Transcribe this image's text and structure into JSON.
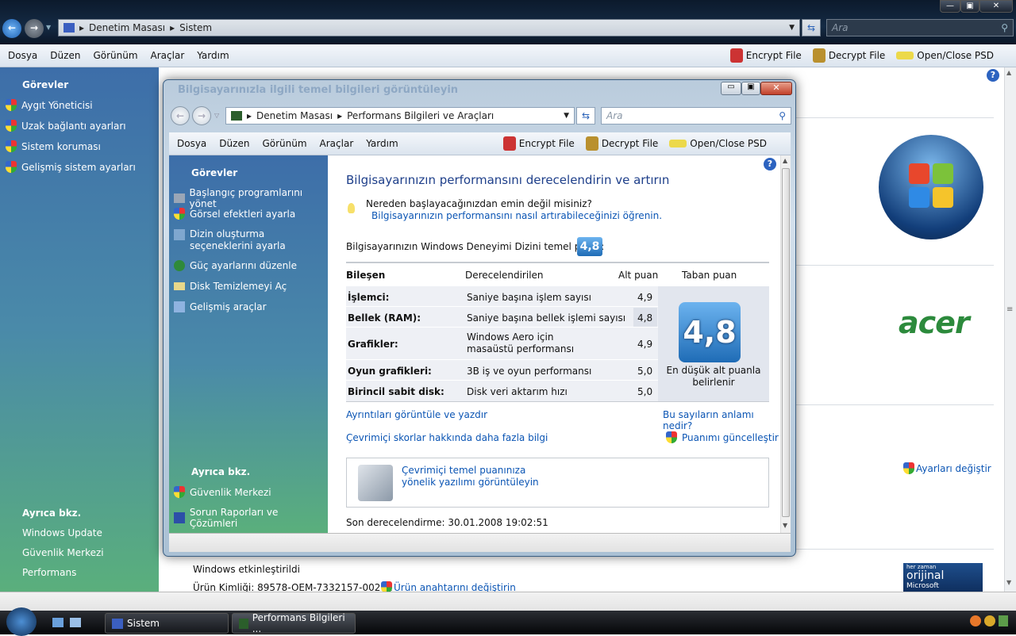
{
  "outer": {
    "breadcrumb": [
      "Denetim Masası",
      "Sistem"
    ],
    "search_placeholder": "Ara",
    "menu": [
      "Dosya",
      "Düzen",
      "Görünüm",
      "Araçlar",
      "Yardım"
    ],
    "tools": [
      "Encrypt File",
      "Decrypt File",
      "Open/Close PSD"
    ],
    "sidebar": {
      "tasks_title": "Görevler",
      "tasks": [
        "Aygıt Yöneticisi",
        "Uzak bağlantı ayarları",
        "Sistem koruması",
        "Gelişmiş sistem ayarları"
      ],
      "see_also_title": "Ayrıca bkz.",
      "see_also": [
        "Windows Update",
        "Güvenlik Merkezi",
        "Performans"
      ]
    },
    "change_settings": "Ayarları değiştir",
    "activation": "Windows etkinleştirildi",
    "product_id_label": "Ürün Kimliği:",
    "product_id": "89578-OEM-7332157-00211",
    "change_key": "Ürün anahtarını değiştirin",
    "brand_logo": "acer",
    "genuine_badge": [
      "her zaman",
      "orijinal",
      "Microsoft"
    ]
  },
  "window": {
    "title": "Bilgisayarınızla ilgili temel bilgileri görüntüleyin",
    "breadcrumb": [
      "Denetim Masası",
      "Performans Bilgileri ve Araçları"
    ],
    "search_placeholder": "Ara",
    "menu": [
      "Dosya",
      "Düzen",
      "Görünüm",
      "Araçlar",
      "Yardım"
    ],
    "tools": [
      "Encrypt File",
      "Decrypt File",
      "Open/Close PSD"
    ],
    "sidebar": {
      "tasks_title": "Görevler",
      "tasks": [
        "Başlangıç programlarını yönet",
        "Görsel efektleri ayarla",
        "Dizin oluşturma seçeneklerini ayarla",
        "Güç ayarlarını düzenle",
        "Disk Temizlemeyi Aç",
        "Gelişmiş araçlar"
      ],
      "see_also_title": "Ayrıca bkz.",
      "see_also": [
        "Güvenlik Merkezi",
        "Sorun Raporları ve Çözümleri"
      ]
    },
    "heading": "Bilgisayarınızın performansını derecelendirin ve artırın",
    "tip_title": "Nereden başlayacağınızdan emin değil misiniz?",
    "tip_link": "Bilgisayarınızın performansını nasıl artırabileceğinizi öğrenin.",
    "base_score_label": "Bilgisayarınızın Windows Deneyimi Dizini temel puanı:",
    "base_score": "4,8",
    "table": {
      "headers": [
        "Bileşen",
        "Derecelendirilen",
        "Alt puan",
        "Taban puan"
      ],
      "rows": [
        {
          "component": "İşlemci:",
          "rated": "Saniye başına işlem sayısı",
          "score": "4,9"
        },
        {
          "component": "Bellek (RAM):",
          "rated": "Saniye başına bellek işlemi sayısı",
          "score": "4,8"
        },
        {
          "component": "Grafikler:",
          "rated": "Windows Aero için masaüstü performansı",
          "score": "4,9"
        },
        {
          "component": "Oyun grafikleri:",
          "rated": "3B iş ve oyun performansı",
          "score": "5,0"
        },
        {
          "component": "Birincil sabit disk:",
          "rated": "Disk veri aktarım hızı",
          "score": "5,0"
        }
      ],
      "base_note": "En düşük alt puanla belirlenir"
    },
    "links": {
      "details": "Ayrıntıları görüntüle ve yazdır",
      "meaning": "Bu sayıların anlamı nedir?",
      "online": "Çevrimiçi skorlar hakkında daha fazla bilgi",
      "update": "Puanımı güncelleştir"
    },
    "software_link": "Çevrimiçi temel puanınıza yönelik yazılımı görüntüleyin",
    "last_rated": "Son derecelendirme: 30.01.2008 19:02:51"
  },
  "taskbar": {
    "items": [
      "Sistem",
      "Performans Bilgileri ..."
    ]
  }
}
